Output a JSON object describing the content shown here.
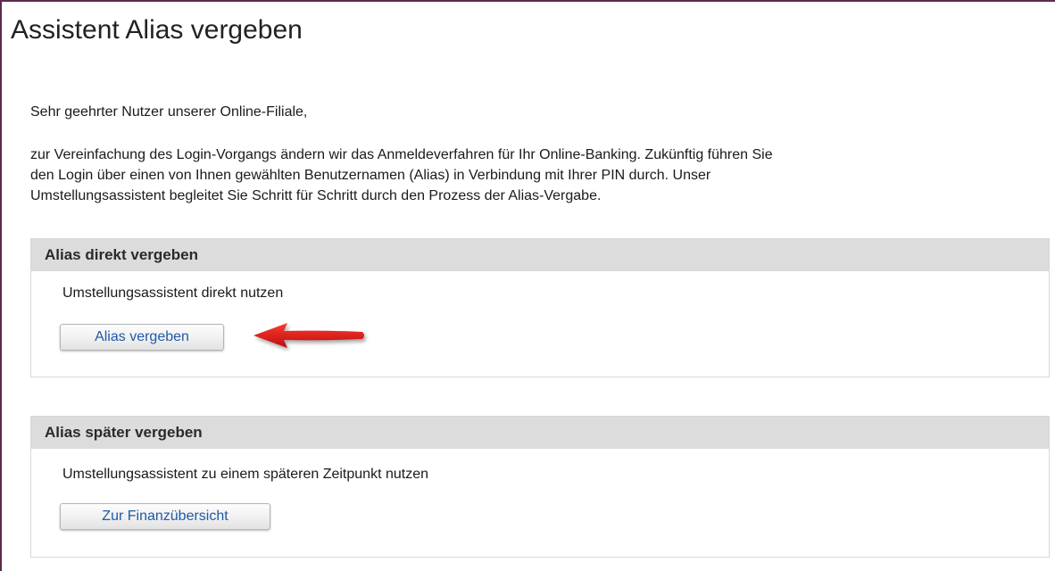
{
  "header": {
    "title": "Assistent Alias vergeben"
  },
  "intro": {
    "greeting": "Sehr geehrter Nutzer unserer Online-Filiale,",
    "lines": [
      "zur Vereinfachung des Login-Vorgangs ändern wir das Anmeldeverfahren für Ihr Online-Banking. Zukünftig führen Sie",
      "den Login über einen von Ihnen gewählten Benutzernamen (Alias) in Verbindung mit Ihrer PIN durch. Unser",
      "Umstellungsassistent begleitet Sie Schritt für Schritt durch den Prozess der Alias-Vergabe."
    ]
  },
  "panels": [
    {
      "heading": "Alias direkt vergeben",
      "description": "Umstellungsassistent direkt nutzen",
      "button_label": "Alias vergeben"
    },
    {
      "heading": "Alias später vergeben",
      "description": "Umstellungsassistent zu einem späteren Zeitpunkt nutzen",
      "button_label": "Zur Finanzübersicht"
    }
  ],
  "annotation": {
    "icon": "red-arrow-left-icon",
    "color": "#e01b1b"
  },
  "colors": {
    "frame_border": "#5a2d4a",
    "panel_header_bg": "#dcdcdc",
    "button_text": "#1f5aa6"
  }
}
